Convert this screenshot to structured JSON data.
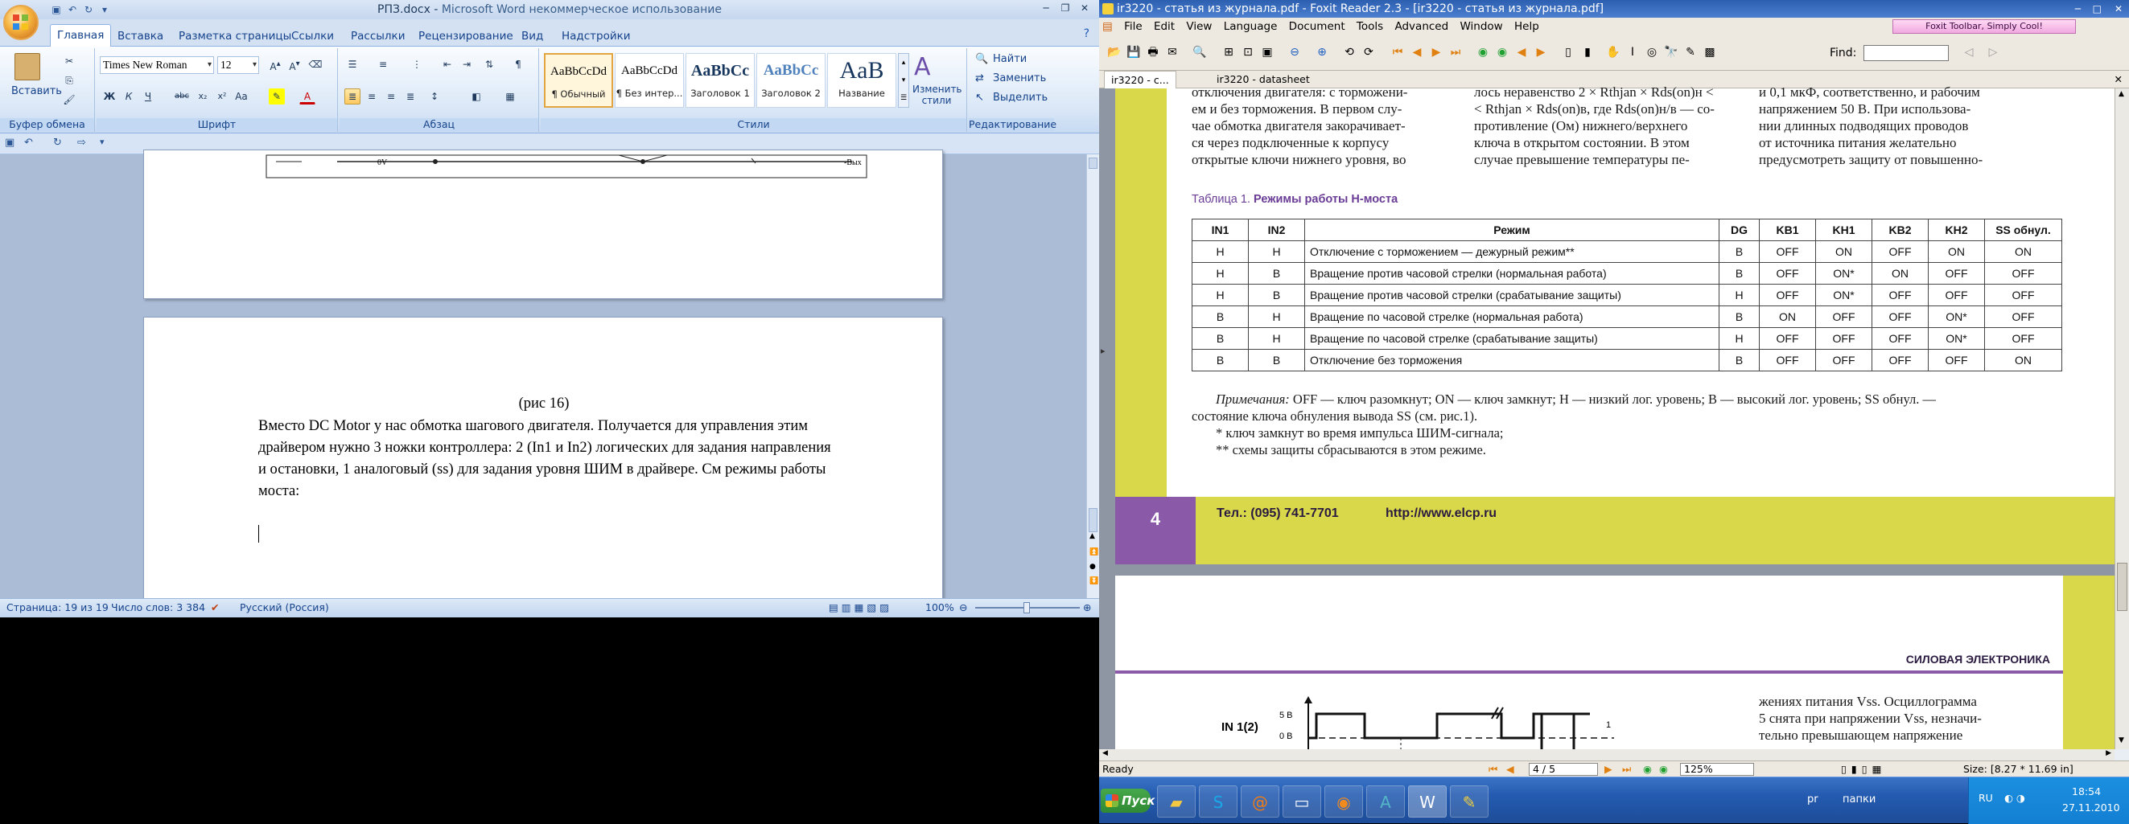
{
  "word": {
    "title_doc": "РПЗ.docx - ",
    "title_app": "Microsoft Word некоммерческое использование",
    "tabs": [
      "Главная",
      "Вставка",
      "Разметка страницы",
      "Ссылки",
      "Рассылки",
      "Рецензирование",
      "Вид",
      "Надстройки"
    ],
    "clipboard": {
      "paste": "Вставить",
      "group": "Буфер обмена"
    },
    "font": {
      "name": "Times New Roman",
      "size": "12",
      "group": "Шрифт"
    },
    "paragraph_group": "Абзац",
    "styles": [
      {
        "sample": "AaBbCcDd",
        "name": "¶ Обычный"
      },
      {
        "sample": "AaBbCcDd",
        "name": "¶ Без интер..."
      },
      {
        "sample": "AaBbCc",
        "name": "Заголовок 1"
      },
      {
        "sample": "AaBbCc",
        "name": "Заголовок 2"
      },
      {
        "sample": "AaB",
        "name": "Название"
      }
    ],
    "change_styles": "Изменить стили",
    "styles_group": "Стили",
    "editing": {
      "find": "Найти",
      "replace": "Заменить",
      "select": "Выделить",
      "group": "Редактирование"
    },
    "figure_labels": {
      "zero": "0V",
      "vout": "-Вых"
    },
    "caption": "(рис 16)",
    "body_lines": [
      "Вместо DC Motor у нас обмотка шагового двигателя. Получается для управления этим",
      "драйвером нужно 3 ножки контроллера: 2 (In1 и In2) логических для задания направления",
      "и остановки, 1 аналоговый (ss) для задания уровня ШИМ в драйвере. См режимы работы",
      "моста:"
    ],
    "status": {
      "page": "Страница: 19 из 19",
      "words": "Число слов: 3 384",
      "lang": "Русский (Россия)",
      "zoom": "100%"
    }
  },
  "foxit": {
    "title": "ir3220 - статья из журнала.pdf - Foxit Reader 2.3 - [ir3220 - статья из журнала.pdf]",
    "menu": [
      "File",
      "Edit",
      "View",
      "Language",
      "Document",
      "Tools",
      "Advanced",
      "Window",
      "Help"
    ],
    "promo": "Foxit Toolbar, Simply Cool!",
    "find_label": "Find:",
    "tabs": [
      "ir3220 - с...",
      "ir3220 - datasheet"
    ],
    "col1": [
      "отключения двигателя: с торможени-",
      "ем и без торможения. В первом слу-",
      "чае обмотка двигателя закорачивает-",
      "ся через подключенные к корпусу",
      "открытые ключи нижнего уровня, во"
    ],
    "col2": [
      "лось неравенство 2 × Rthjan × Rds(on)н <",
      "< Rthjan × Rds(on)в, где Rds(on)н/в — со-",
      "противление (Ом) нижнего/верхнего",
      "ключа в открытом состоянии. В этом",
      "случае превышение температуры пе-"
    ],
    "col3": [
      "и 0,1 мкФ, соответственно, и рабочим",
      "напряжением 50 В. При использова-",
      "нии длинных подводящих проводов",
      "от источника питания желательно",
      "предусмотреть защиту от повышенно-"
    ],
    "table_caption_prefix": "Таблица 1.",
    "table_caption_title": "Режимы работы Н-моста",
    "table_headers": [
      "IN1",
      "IN2",
      "Режим",
      "DG",
      "KB1",
      "KH1",
      "KB2",
      "KH2",
      "SS обнул."
    ],
    "table_rows": [
      [
        "Н",
        "Н",
        "Отключение с торможением — дежурный режим**",
        "В",
        "OFF",
        "ON",
        "OFF",
        "ON",
        "ON"
      ],
      [
        "Н",
        "В",
        "Вращение против часовой стрелки (нормальная работа)",
        "В",
        "OFF",
        "ON*",
        "ON",
        "OFF",
        "OFF"
      ],
      [
        "Н",
        "В",
        "Вращение против часовой стрелки (срабатывание защиты)",
        "Н",
        "OFF",
        "ON*",
        "OFF",
        "OFF",
        "OFF"
      ],
      [
        "В",
        "Н",
        "Вращение по часовой стрелке (нормальная работа)",
        "В",
        "ON",
        "OFF",
        "OFF",
        "ON*",
        "OFF"
      ],
      [
        "В",
        "Н",
        "Вращение по часовой стрелке (срабатывание защиты)",
        "Н",
        "OFF",
        "OFF",
        "OFF",
        "ON*",
        "OFF"
      ],
      [
        "В",
        "В",
        "Отключение без торможения",
        "В",
        "OFF",
        "OFF",
        "OFF",
        "OFF",
        "ON"
      ]
    ],
    "notes_label": "Примечания:",
    "notes_text": " OFF — ключ разомкнут; ON — ключ замкнут; Н — низкий лог. уровень; В — высокий лог. уровень; SS обнул. —",
    "notes_text2": "состояние ключа обнуления вывода SS (см. рис.1).",
    "note1": "* ключ замкнут во время импульса ШИМ-сигнала;",
    "note2": "** схемы защиты сбрасываются в этом режиме.",
    "page_number": "4",
    "phone": "Тел.: (095) 741-7701",
    "site": "http://www.elcp.ru",
    "section": "СИЛОВАЯ ЭЛЕКТРОНИКА",
    "osc_label": "IN 1(2)",
    "osc_5v": "5 В",
    "osc_0v": "0 В",
    "osc_marker": "1",
    "next_col": [
      "жениях питания Vss. Осциллограмма",
      "5 снята при напряжении Vss, незначи-",
      "тельно превышающем напряжение"
    ],
    "status_ready": "Ready",
    "page_field": "4 / 5",
    "zoom": "125%",
    "size": "Size: [8.27 * 11.69 in]"
  },
  "taskbar": {
    "start": "Пуск",
    "tray_items": [
      "pr",
      "папки",
      "RU"
    ],
    "time": "18:54",
    "date": "27.11.2010"
  }
}
